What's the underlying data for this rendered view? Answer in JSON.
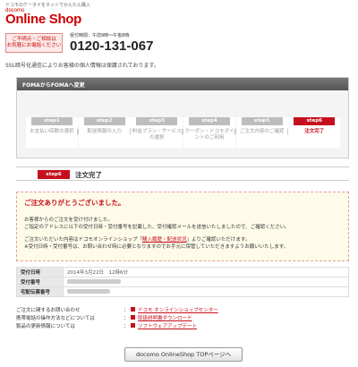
{
  "header": {
    "tagline": "ドコモのケータイをネットでかんたん購入",
    "brand": "docomo",
    "shop_name": "Online Shop",
    "contact_box": [
      "ご不明点・ご相談は",
      "お気軽にお電話ください"
    ],
    "hours": "受付時間：午前9時〜午後8時",
    "phone": "0120-131-067",
    "ssl_note": "SSL暗号化通信によりお客様の個人情報は保護されております。"
  },
  "steps_panel": {
    "title": "FOMAからFOMAへ変更",
    "steps": [
      {
        "num": "step1",
        "label": "お支払い回数の選択",
        "active": false
      },
      {
        "num": "step2",
        "label": "配送情報の入力",
        "active": false
      },
      {
        "num": "step3",
        "label": "料金プラン・サービスの選択",
        "active": false
      },
      {
        "num": "step4",
        "label": "クーポン・ドコモポイントのご利用",
        "active": false
      },
      {
        "num": "step5",
        "label": "ご注文内容のご確認",
        "active": false
      },
      {
        "num": "step6",
        "label": "注文完了",
        "active": true
      }
    ]
  },
  "section": {
    "tag": "step6",
    "title": "注文完了"
  },
  "notice": {
    "thanks": "ご注文ありがとうございました。",
    "line1": "お客様からのご注文を受け付けました。",
    "line2": "ご指定のアドレスに以下の受付日時・受付番号を記載した、受付確認メールを送信いたしましたので、ご確認ください。",
    "line3_pre": "ご注文いただいた内容はドコモオンラインショップ「",
    "line3_link": "購入履歴・配送状況",
    "line3_post": "」よりご確認いただけます。",
    "line4": "※受付日時・受付番号は、お問い合わせ時に必要となりますのでお手元に保管していただきますようお願いいたします。"
  },
  "order_info": {
    "rows": [
      {
        "key": "受付日時",
        "value": "2014年3月22日　12時6分"
      },
      {
        "key": "受付番号",
        "value": ""
      },
      {
        "key": "宅配伝票番号",
        "value": ""
      }
    ]
  },
  "help_links": [
    {
      "label": "ご注文に関するお問い合わせ",
      "link": "ドコモ オンラインショップセンター"
    },
    {
      "label": "携帯電話の操作方法などについては",
      "link": "取扱説明書ダウンロード"
    },
    {
      "label": "製品の更新情報については",
      "link": "ソフトウェアアップデート"
    }
  ],
  "buttons": {
    "top": "docomo OnlineShop TOPページへ"
  },
  "colors": {
    "accent": "#c60f1e",
    "notice_bg": "#fffbe9"
  }
}
